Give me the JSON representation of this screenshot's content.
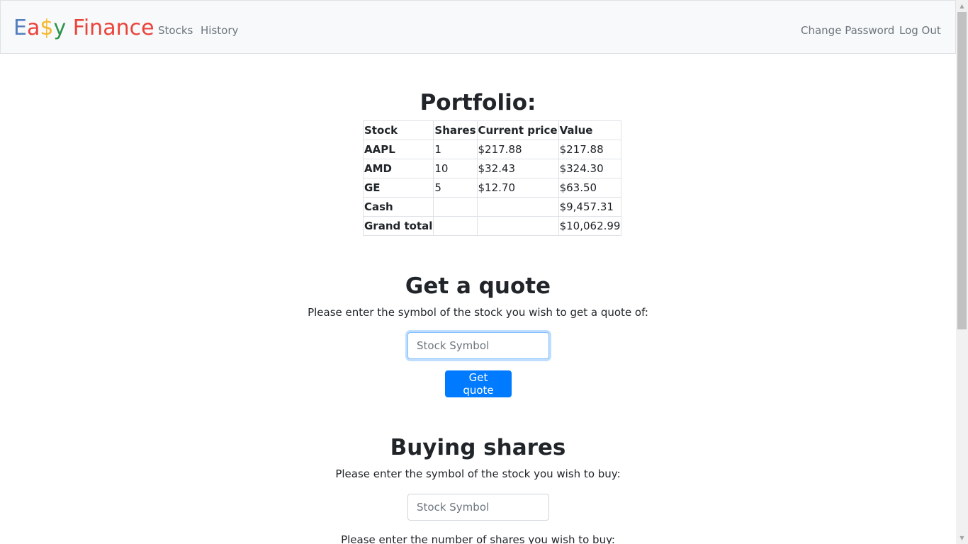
{
  "navbar": {
    "brand_parts": [
      "E",
      "a",
      "$",
      "y",
      " ",
      "Finance"
    ],
    "brand_colors": [
      "#537fbe",
      "#ea433b",
      "#f5b82e",
      "#2e944b",
      "#ea433b"
    ],
    "links": {
      "stocks": "Stocks",
      "history": "History",
      "change_password": "Change Password",
      "log_out": "Log Out"
    }
  },
  "portfolio": {
    "title": "Portfolio:",
    "headers": [
      "Stock",
      "Shares",
      "Current price",
      "Value"
    ],
    "rows": [
      {
        "stock": "AAPL",
        "shares": "1",
        "price": "$217.88",
        "value": "$217.88"
      },
      {
        "stock": "AMD",
        "shares": "10",
        "price": "$32.43",
        "value": "$324.30"
      },
      {
        "stock": "GE",
        "shares": "5",
        "price": "$12.70",
        "value": "$63.50"
      },
      {
        "stock": "Cash",
        "shares": "",
        "price": "",
        "value": "$9,457.31"
      },
      {
        "stock": "Grand total",
        "shares": "",
        "price": "",
        "value": "$10,062.99"
      }
    ]
  },
  "quote": {
    "title": "Get a quote",
    "instruction": "Please enter the symbol of the stock you wish to get a quote of:",
    "input_placeholder": "Stock Symbol",
    "button_label": "Get quote"
  },
  "buy": {
    "title": "Buying shares",
    "instruction": "Please enter the symbol of the stock you wish to buy:",
    "input_placeholder": "Stock Symbol",
    "shares_instruction": "Please enter the number of shares you wish to buy:"
  },
  "colors": {
    "primary": "#007bff",
    "navbar_bg": "#f8f9fa"
  }
}
